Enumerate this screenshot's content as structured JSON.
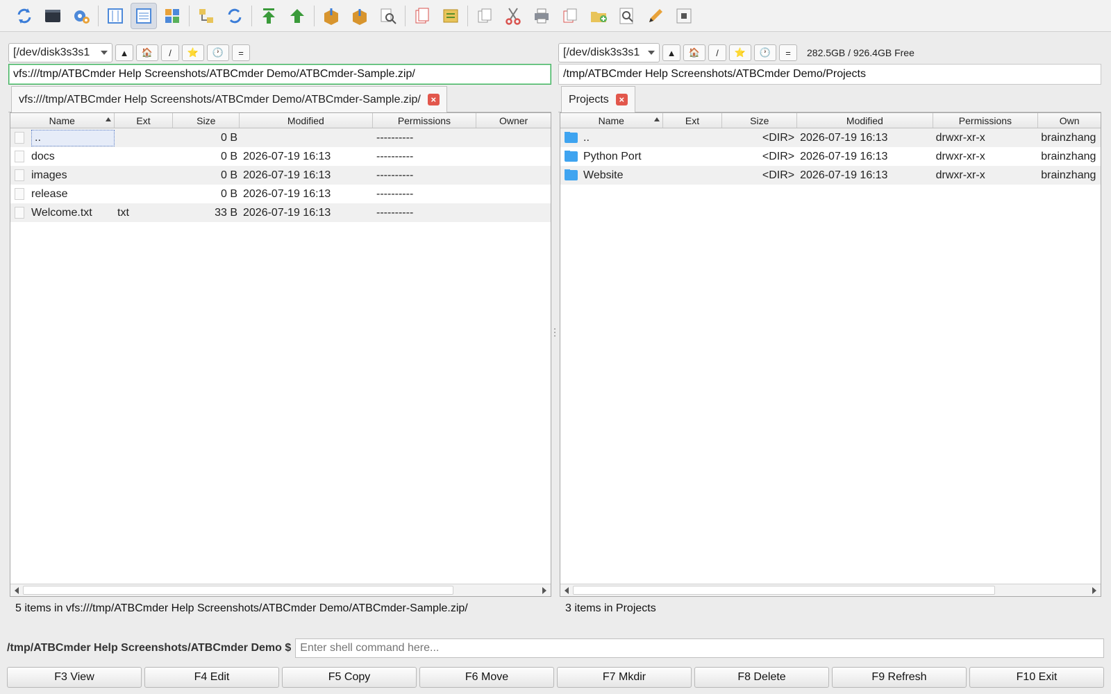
{
  "toolbar": {
    "icons": [
      "refresh-icon",
      "terminal-icon",
      "settings-icon",
      "brief-view-icon",
      "detailed-view-icon",
      "thumbnail-view-icon",
      "compare-dirs-icon",
      "sync-dirs-icon",
      "go-root-icon",
      "go-up-icon",
      "pack-icon",
      "unpack-icon",
      "find-icon",
      "new-tab-icon",
      "bookmark-icon",
      "copy-icon",
      "cut-icon",
      "print-icon",
      "paste-icon",
      "new-folder-icon",
      "preview-icon",
      "edit-icon",
      "properties-icon"
    ]
  },
  "left": {
    "drive": "[/dev/disk3s3s1",
    "nav": {
      "up": "▲",
      "home": "🏠",
      "root": "/",
      "favorite": "⭐",
      "history": "🕐",
      "equal": "="
    },
    "path": "vfs:///tmp/ATBCmder Help Screenshots/ATBCmder Demo/ATBCmder-Sample.zip/",
    "tab_label": "vfs:///tmp/ATBCmder Help Screenshots/ATBCmder Demo/ATBCmder-Sample.zip/",
    "columns": [
      "Name",
      "Ext",
      "Size",
      "Modified",
      "Permissions",
      "Owner"
    ],
    "rows": [
      {
        "name": "..",
        "ext": "",
        "size": "0 B",
        "modified": "",
        "permissions": "----------"
      },
      {
        "name": "docs",
        "ext": "",
        "size": "0 B",
        "modified": "2026-07-19 16:13",
        "permissions": "----------"
      },
      {
        "name": "images",
        "ext": "",
        "size": "0 B",
        "modified": "2026-07-19 16:13",
        "permissions": "----------"
      },
      {
        "name": "release",
        "ext": "",
        "size": "0 B",
        "modified": "2026-07-19 16:13",
        "permissions": "----------"
      },
      {
        "name": "Welcome.txt",
        "ext": "txt",
        "size": "33 B",
        "modified": "2026-07-19 16:13",
        "permissions": "----------"
      }
    ],
    "status": "5 items in vfs:///tmp/ATBCmder Help Screenshots/ATBCmder Demo/ATBCmder-Sample.zip/"
  },
  "right": {
    "drive": "[/dev/disk3s3s1",
    "nav": {
      "up": "▲",
      "home": "🏠",
      "root": "/",
      "favorite": "⭐",
      "history": "🕐",
      "equal": "="
    },
    "free_space": "282.5GB / 926.4GB Free",
    "path": "/tmp/ATBCmder Help Screenshots/ATBCmder Demo/Projects",
    "tab_label": "Projects",
    "columns": [
      "Name",
      "Ext",
      "Size",
      "Modified",
      "Permissions",
      "Own"
    ],
    "rows": [
      {
        "name": "..",
        "ext": "",
        "size": "<DIR>",
        "modified": "2026-07-19 16:13",
        "permissions": "drwxr-xr-x",
        "owner": "brainzhang"
      },
      {
        "name": "Python Port",
        "ext": "",
        "size": "<DIR>",
        "modified": "2026-07-19 16:13",
        "permissions": "drwxr-xr-x",
        "owner": "brainzhang"
      },
      {
        "name": "Website",
        "ext": "",
        "size": "<DIR>",
        "modified": "2026-07-19 16:13",
        "permissions": "drwxr-xr-x",
        "owner": "brainzhang"
      }
    ],
    "status": "3 items in Projects"
  },
  "command": {
    "prompt": "/tmp/ATBCmder Help Screenshots/ATBCmder Demo $",
    "placeholder": "Enter shell command here..."
  },
  "fkeys": [
    "F3 View",
    "F4 Edit",
    "F5 Copy",
    "F6 Move",
    "F7 Mkdir",
    "F8 Delete",
    "F9 Refresh",
    "F10 Exit"
  ],
  "colors": {
    "accent_green": "#3fae5c",
    "folder_blue": "#3fa4f0",
    "close_red": "#e2574c"
  }
}
